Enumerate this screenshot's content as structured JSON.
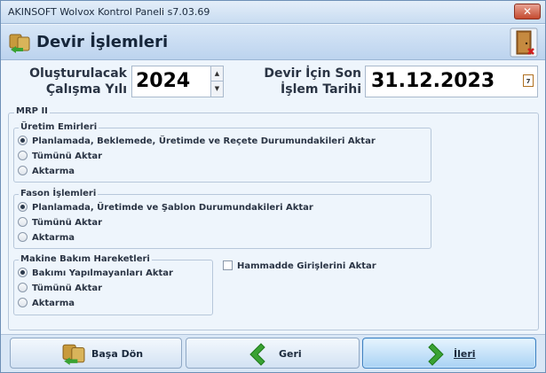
{
  "window": {
    "title": "AKINSOFT Wolvox Kontrol Paneli s7.03.69",
    "close_glyph": "✕"
  },
  "header": {
    "title": "Devir İşlemleri"
  },
  "form": {
    "year_label_line1": "Oluşturulacak",
    "year_label_line2": "Çalışma Yılı",
    "year_value": "2024",
    "date_label_line1": "Devir İçin Son",
    "date_label_line2": "İşlem Tarihi",
    "date_value": "31.12.2023",
    "calendar_day": "7"
  },
  "mrp": {
    "title": "MRP II",
    "uretim": {
      "title": "Üretim Emirleri",
      "options": [
        "Planlamada, Beklemede, Üretimde ve Reçete Durumundakileri Aktar",
        "Tümünü Aktar",
        "Aktarma"
      ],
      "selected": 0
    },
    "fason": {
      "title": "Fason İşlemleri",
      "options": [
        "Planlamada, Üretimde ve Şablon Durumundakileri Aktar",
        "Tümünü Aktar",
        "Aktarma"
      ],
      "selected": 0
    },
    "makine": {
      "title": "Makine Bakım Hareketleri",
      "options": [
        "Bakımı Yapılmayanları Aktar",
        "Tümünü Aktar",
        "Aktarma"
      ],
      "selected": 0
    },
    "hammadde_label": "Hammadde Girişlerini Aktar",
    "hammadde_checked": false
  },
  "footer": {
    "basa_don": "Başa Dön",
    "geri": "Geri",
    "ileri": "İleri"
  },
  "icons": {
    "header": "transfer-icon",
    "exit": "exit-door-icon",
    "basa_don": "transfer-icon",
    "geri": "arrow-left-icon",
    "ileri": "arrow-right-icon",
    "calendar": "calendar-icon"
  },
  "colors": {
    "accent": "#3c7fc0",
    "arrow_green": "#3aa233"
  }
}
